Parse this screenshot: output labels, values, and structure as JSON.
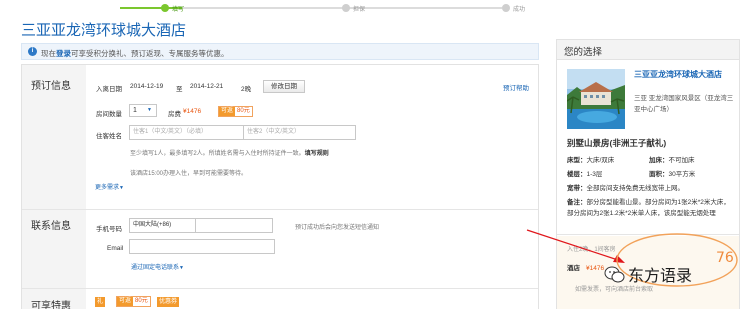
{
  "progress": {
    "steps": [
      "填写",
      "担保",
      "成功"
    ]
  },
  "hotel": {
    "name": "三亚亚龙湾环球城大酒店"
  },
  "notice": {
    "prefix": "现在",
    "login": "登录",
    "suffix": "可享受积分换礼、预订返现、专属服务等优惠。"
  },
  "booking": {
    "section_title": "预订信息",
    "checkin_label": "入离日期",
    "checkin_date": "2014-12-19",
    "to": "至",
    "checkout_date": "2014-12-21",
    "nights": "2晚",
    "modify_date": "修改日期",
    "help": "预订帮助",
    "room_count_label": "房间数量",
    "room_count": "1",
    "room_fee_label": "房费",
    "room_fee": "¥1476",
    "rebate_label": "可返",
    "rebate_value": "80元",
    "guest_label": "住客姓名",
    "guest1_placeholder": "住客1（中文/英文）（必填）",
    "guest2_placeholder": "住客2（中文/英文）",
    "hint": "至少填写1人，最多填写2人。所填姓名需与入住时所持证件一致。",
    "hint_link": "填写规则",
    "store_note": "该酒店15:00办理入住，早到可能需要等待。",
    "more": "更多需求"
  },
  "contact": {
    "section_title": "联系信息",
    "phone_label": "手机号码",
    "phone_prefix": "中国大陆(+86)",
    "phone_hint": "预订成功后会向您发送短信通知",
    "email_label": "Email",
    "fixed_phone": "通过固定电话联系"
  },
  "benefits": {
    "section_title": "可享特惠",
    "gift": "礼",
    "rebate_label": "可返",
    "rebate_value": "80元",
    "coupon": "优惠券"
  },
  "sidebar": {
    "title": "您的选择",
    "hotel_name": "三亚亚龙湾环球城大酒店",
    "address": "三亚 亚龙湾国家风景区（亚龙湾三亚中心广场）",
    "room_name": "别墅山景房(非洲王子献礼)",
    "specs": [
      {
        "k": "床型：",
        "v": "大床/双床"
      },
      {
        "k": "加床：",
        "v": "不可加床"
      },
      {
        "k": "楼层：",
        "v": "1-3层"
      },
      {
        "k": "面积：",
        "v": "30平方米"
      },
      {
        "k": "宽带：",
        "v": "全部房间支持免费无线宽带上网。"
      }
    ],
    "note_label": "备注：",
    "note": "部分房型能看山景。部分房间为1张2米*2米大床，部分房间为2张1.2米*2米单人床，该房型能无烟处理",
    "checkin_line": "入住2晚，1间客房",
    "price_label": "酒店",
    "price_hidden": "¥1476",
    "footer": "如需发票，可向酒店前台索取",
    "overlay_number": "76"
  },
  "watermark": {
    "text": "东方语录"
  },
  "colors": {
    "accent": "#1a66b5",
    "price": "#e8540e",
    "progress_active": "#7bc72e",
    "annotation": "#e0171c"
  }
}
